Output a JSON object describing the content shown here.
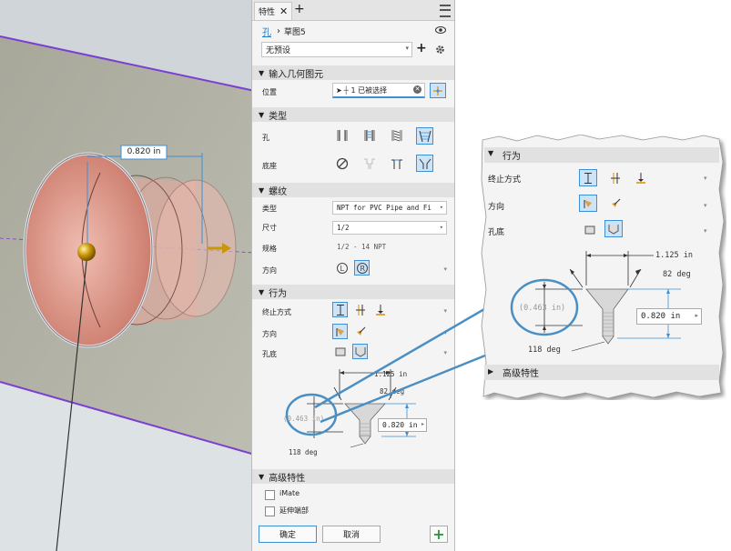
{
  "tab": {
    "title": "特性",
    "close": "✕",
    "add": "+"
  },
  "breadcrumb": {
    "part": "孔",
    "sep": "›",
    "sketch": "草图5"
  },
  "preset": {
    "value": "无预设"
  },
  "sections": {
    "geometry": {
      "title": "输入几何图元",
      "position_label": "位置",
      "selection_text": "1 已被选择"
    },
    "type": {
      "title": "类型",
      "hole_label": "孔",
      "seat_label": "底座"
    },
    "thread": {
      "title": "螺纹",
      "type_label": "类型",
      "type_value": "NPT for PVC Pipe and Fi",
      "size_label": "尺寸",
      "size_value": "1/2",
      "spec_label": "规格",
      "spec_value": "1/2 - 14 NPT",
      "direction_label": "方向"
    },
    "behavior": {
      "title": "行为",
      "termination_label": "终止方式",
      "direction_label": "方向",
      "bottom_label": "孔底",
      "dim_top": "1.125 in",
      "dim_angle": "82 deg",
      "dim_depth": "(0.463 in)",
      "dim_length": "0.820 in",
      "dim_tip": "118 deg"
    },
    "advanced": {
      "title": "高级特性",
      "imate": "iMate",
      "extend": "延伸端部"
    }
  },
  "buttons": {
    "ok": "确定",
    "cancel": "取消",
    "add": "+"
  },
  "viewport": {
    "dimension": "0.820 in"
  },
  "colors": {
    "accent": "#3d8fd6",
    "callout_line": "#4a8fc4",
    "cone_fill": "#e0a59a",
    "green": "#2a9a3a"
  }
}
